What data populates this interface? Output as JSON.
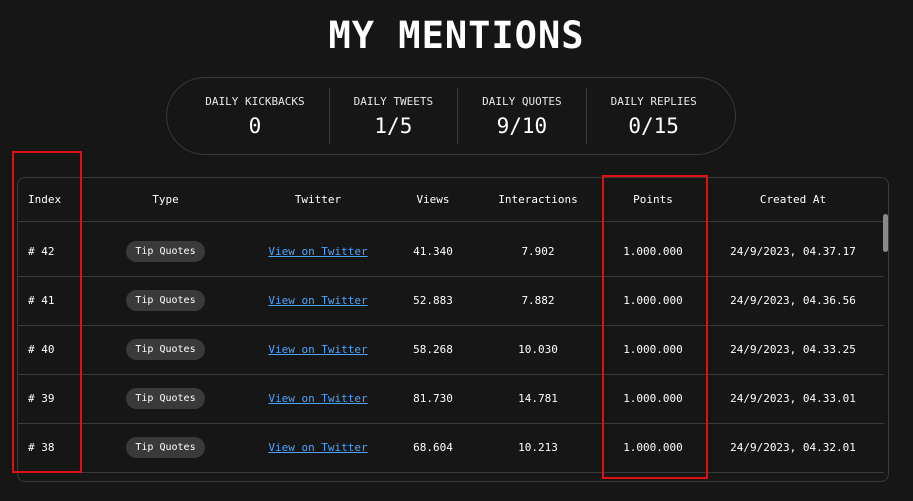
{
  "title": "MY MENTIONS",
  "stats": [
    {
      "label": "DAILY KICKBACKS",
      "value": "0"
    },
    {
      "label": "DAILY TWEETS",
      "value": "1/5"
    },
    {
      "label": "DAILY QUOTES",
      "value": "9/10"
    },
    {
      "label": "DAILY REPLIES",
      "value": "0/15"
    }
  ],
  "table": {
    "headers": {
      "index": "Index",
      "type": "Type",
      "twitter": "Twitter",
      "views": "Views",
      "interactions": "Interactions",
      "points": "Points",
      "created_at": "Created At"
    },
    "rows": [
      {
        "index": "# 42",
        "type": "Tip Quotes",
        "twitter": "View on Twitter",
        "views": "41.340",
        "interactions": "7.902",
        "points": "1.000.000",
        "created_at": "24/9/2023, 04.37.17"
      },
      {
        "index": "# 41",
        "type": "Tip Quotes",
        "twitter": "View on Twitter",
        "views": "52.883",
        "interactions": "7.882",
        "points": "1.000.000",
        "created_at": "24/9/2023, 04.36.56"
      },
      {
        "index": "# 40",
        "type": "Tip Quotes",
        "twitter": "View on Twitter",
        "views": "58.268",
        "interactions": "10.030",
        "points": "1.000.000",
        "created_at": "24/9/2023, 04.33.25"
      },
      {
        "index": "# 39",
        "type": "Tip Quotes",
        "twitter": "View on Twitter",
        "views": "81.730",
        "interactions": "14.781",
        "points": "1.000.000",
        "created_at": "24/9/2023, 04.33.01"
      },
      {
        "index": "# 38",
        "type": "Tip Quotes",
        "twitter": "View on Twitter",
        "views": "68.604",
        "interactions": "10.213",
        "points": "1.000.000",
        "created_at": "24/9/2023, 04.32.01"
      }
    ]
  },
  "colors": {
    "background": "#161616",
    "link": "#4ea3ff",
    "badge": "#3a3a3a",
    "highlight": "#e01010"
  }
}
